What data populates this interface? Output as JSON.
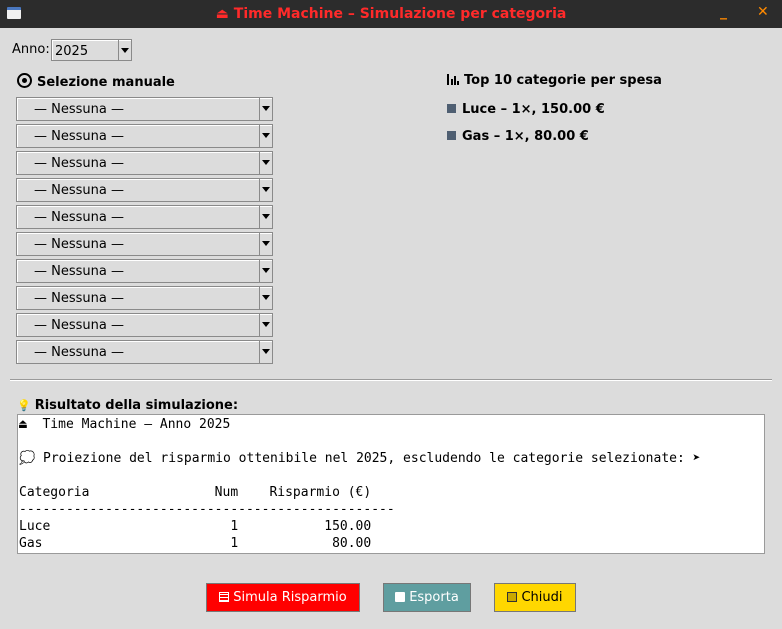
{
  "window": {
    "title": "Time Machine – Simulazione per categoria",
    "title_icon": "⏏",
    "minimize_glyph": "_",
    "close_glyph": "✕"
  },
  "year": {
    "label": "Anno:",
    "value": "2025"
  },
  "manual": {
    "header": "Selezione manuale",
    "selects": [
      "— Nessuna —",
      "— Nessuna —",
      "— Nessuna —",
      "— Nessuna —",
      "— Nessuna —",
      "— Nessuna —",
      "— Nessuna —",
      "— Nessuna —",
      "— Nessuna —",
      "— Nessuna —"
    ]
  },
  "top": {
    "header": "Top 10 categorie per spesa",
    "items": [
      "Luce – 1×, 150.00 €",
      "Gas – 1×, 80.00 €"
    ],
    "bullet_color": "#4f5f72"
  },
  "result": {
    "header": "Risultato della simulazione:",
    "lines": [
      "⏏  Time Machine – Anno 2025",
      "",
      "💭 Proiezione del risparmio ottenibile nel 2025, escludendo le categorie selezionate: ➤",
      "",
      "Categoria                Num    Risparmio (€)",
      "------------------------------------------------",
      "Luce                       1           150.00",
      "Gas                        1            80.00"
    ]
  },
  "buttons": {
    "simulate": "Simula Risparmio",
    "export": "Esporta",
    "close": "Chiudi"
  },
  "colors": {
    "title_text": "#ff2a2a",
    "simulate_bg": "#ff0000",
    "export_bg": "#5f9ea0",
    "close_bg": "#ffd700"
  }
}
